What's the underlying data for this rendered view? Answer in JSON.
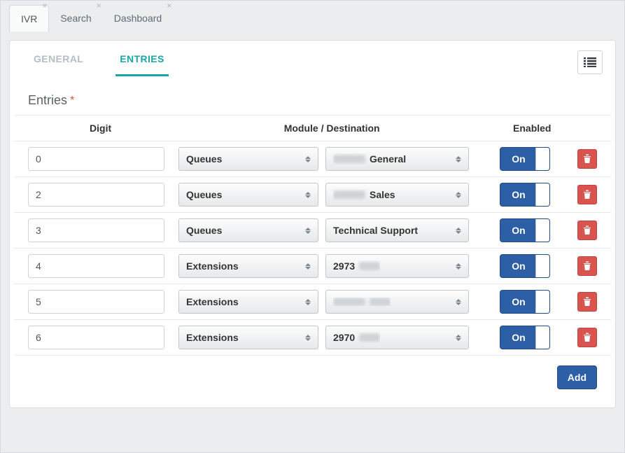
{
  "top_tabs": [
    {
      "label": "IVR",
      "active": true
    },
    {
      "label": "Search",
      "active": false
    },
    {
      "label": "Dashboard",
      "active": false
    }
  ],
  "inner_tabs": {
    "general": "GENERAL",
    "entries": "ENTRIES",
    "active": "entries"
  },
  "section": {
    "title": "Entries",
    "required_mark": "*"
  },
  "headers": {
    "digit": "Digit",
    "module": "Module / Destination",
    "enabled": "Enabled"
  },
  "toggle_on_label": "On",
  "add_button": "Add",
  "close_glyph": "×",
  "rows": [
    {
      "digit": "0",
      "module": "Queues",
      "destination": "General",
      "dest_blurred_prefix": true,
      "dest_blurred_suffix": false,
      "enabled": true
    },
    {
      "digit": "2",
      "module": "Queues",
      "destination": "Sales",
      "dest_blurred_prefix": true,
      "dest_blurred_suffix": false,
      "enabled": true
    },
    {
      "digit": "3",
      "module": "Queues",
      "destination": "Technical Support",
      "dest_blurred_prefix": false,
      "dest_blurred_suffix": false,
      "enabled": true
    },
    {
      "digit": "4",
      "module": "Extensions",
      "destination": "2973",
      "dest_blurred_prefix": false,
      "dest_blurred_suffix": true,
      "enabled": true
    },
    {
      "digit": "5",
      "module": "Extensions",
      "destination": "",
      "dest_blurred_prefix": true,
      "dest_blurred_suffix": true,
      "enabled": true
    },
    {
      "digit": "6",
      "module": "Extensions",
      "destination": "2970",
      "dest_blurred_prefix": false,
      "dest_blurred_suffix": true,
      "enabled": true
    }
  ]
}
